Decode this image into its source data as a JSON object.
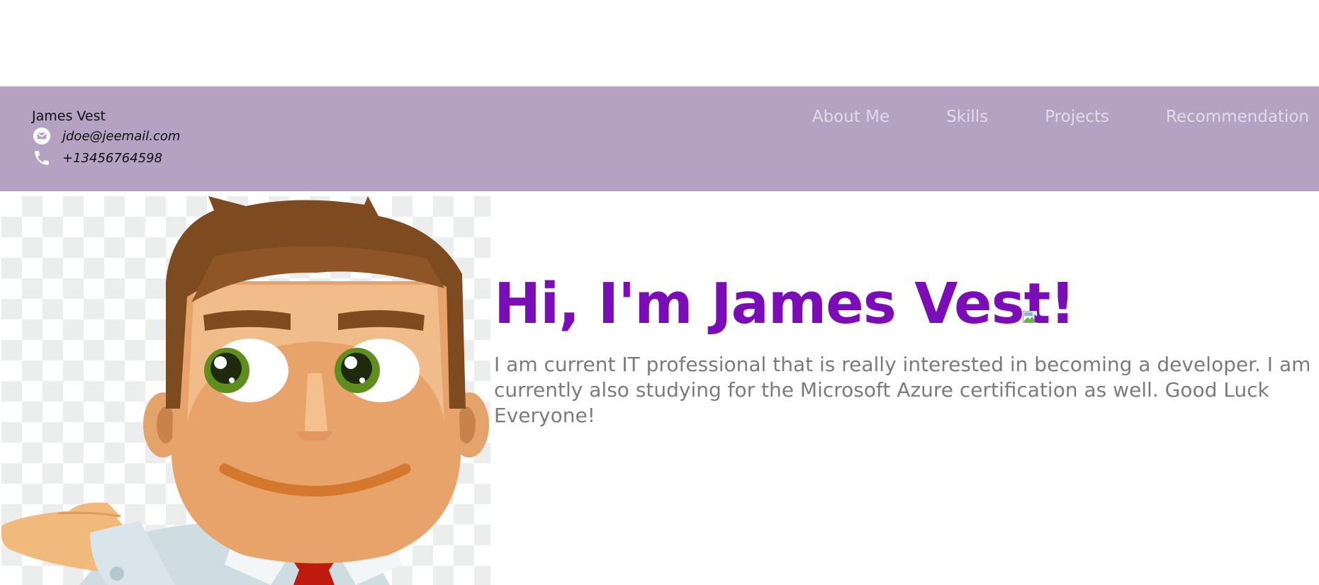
{
  "header": {
    "name": "James Vest",
    "email": "jdoe@jeemail.com",
    "phone": "+13456764598",
    "email_icon": "envelope-icon",
    "phone_icon": "phone-icon",
    "background_color": "#b5a1c2"
  },
  "nav": {
    "items": [
      {
        "label": "About Me"
      },
      {
        "label": "Skills"
      },
      {
        "label": "Projects"
      },
      {
        "label": "Recommendation"
      }
    ],
    "text_color": "#e2dae7"
  },
  "hero": {
    "title": "Hi, I'm James Vest!",
    "title_color": "#7a0db8",
    "description": "I am current IT professional that is really interested in becoming a developer. I am currently also studying for the Microsoft Azure certification as well. Good Luck Everyone!",
    "avatar": "cartoon-man-avatar",
    "title_image": "broken-image-icon"
  }
}
